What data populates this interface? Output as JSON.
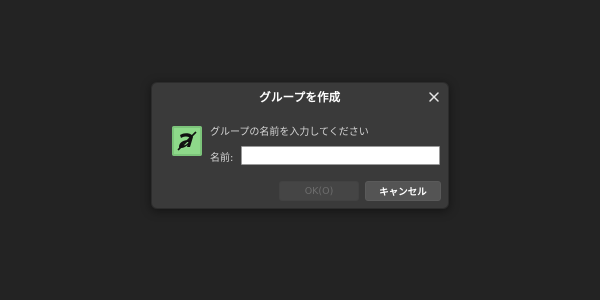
{
  "dialog": {
    "title": "グループを作成",
    "prompt": "グループの名前を入力してください",
    "name_label": "名前:",
    "name_value": "",
    "ok_label": "OK(O)",
    "cancel_label": "キャンセル",
    "close_icon": "close-icon",
    "logo_icon": "app-logo-a"
  },
  "colors": {
    "backdrop": "#232323",
    "dialog_bg": "#3a3a3a",
    "logo_green": "#8ed98a",
    "ok_disabled_text": "#6d6d6d",
    "cancel_bg": "#545454"
  }
}
